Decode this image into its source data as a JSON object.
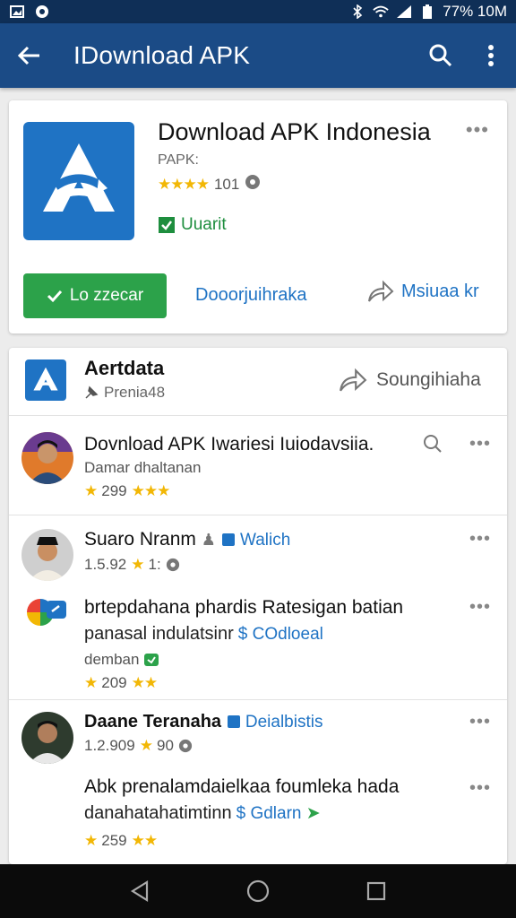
{
  "status_bar": {
    "status_text": "77% 10M"
  },
  "app_bar": {
    "title": "IDownload APK",
    "icons": [
      "back-arrow-icon",
      "search-icon",
      "more-vert-icon"
    ]
  },
  "app_card": {
    "name": "Download APK Indonesia",
    "developer": "PAPK:",
    "rating_count": "101",
    "verified_label": "Uuarit",
    "install_label": "Lo zzecar",
    "download_label": "Dooorjuihraka",
    "share_label": "Msiuaa kr",
    "stars_filled": 4
  },
  "section": {
    "title": "Aertdata",
    "subtitle": "Prenia48",
    "share_label": "Soungihiaha"
  },
  "reviews": [
    {
      "title": "Dovnload APK Iwariesi Iuiodavsiia.",
      "line1": "Damar dhaltanan",
      "line2_num": "299",
      "line2_stars": "★★★",
      "lead_star": "★"
    },
    {
      "title": "Suaro Nranm",
      "badge": "Walich",
      "line1_num": "1.5.92",
      "line1_star_num": "1:",
      "stars": "★"
    },
    {
      "title": "brtepdahana phardis Ratesigan batian",
      "line1a": "panasal indulatsinr",
      "badge": "COdloeal",
      "line2": "demban",
      "line3_num": "209",
      "stars": "★★",
      "lead_star": "★"
    },
    {
      "title": "Daane Teranaha",
      "badge": "Deialbistis",
      "line1_num": "1.2.909",
      "line1_star_num": "90",
      "stars": "★"
    },
    {
      "title": "Abk prenalamdaielkaa foumleka hada",
      "line1a": "danahatahatimtinn",
      "badge": "Gdlarn",
      "line2_num": "259",
      "stars": "★★",
      "lead_star": "★"
    }
  ],
  "nav": {
    "icons": [
      "nav-back-icon",
      "nav-home-icon",
      "nav-recents-icon"
    ]
  },
  "colors": {
    "app_bar": "#1b4b86",
    "status_bar": "#0f2f57",
    "accent": "#1f73c4",
    "install": "#2ca24a",
    "star": "#f2b705"
  }
}
